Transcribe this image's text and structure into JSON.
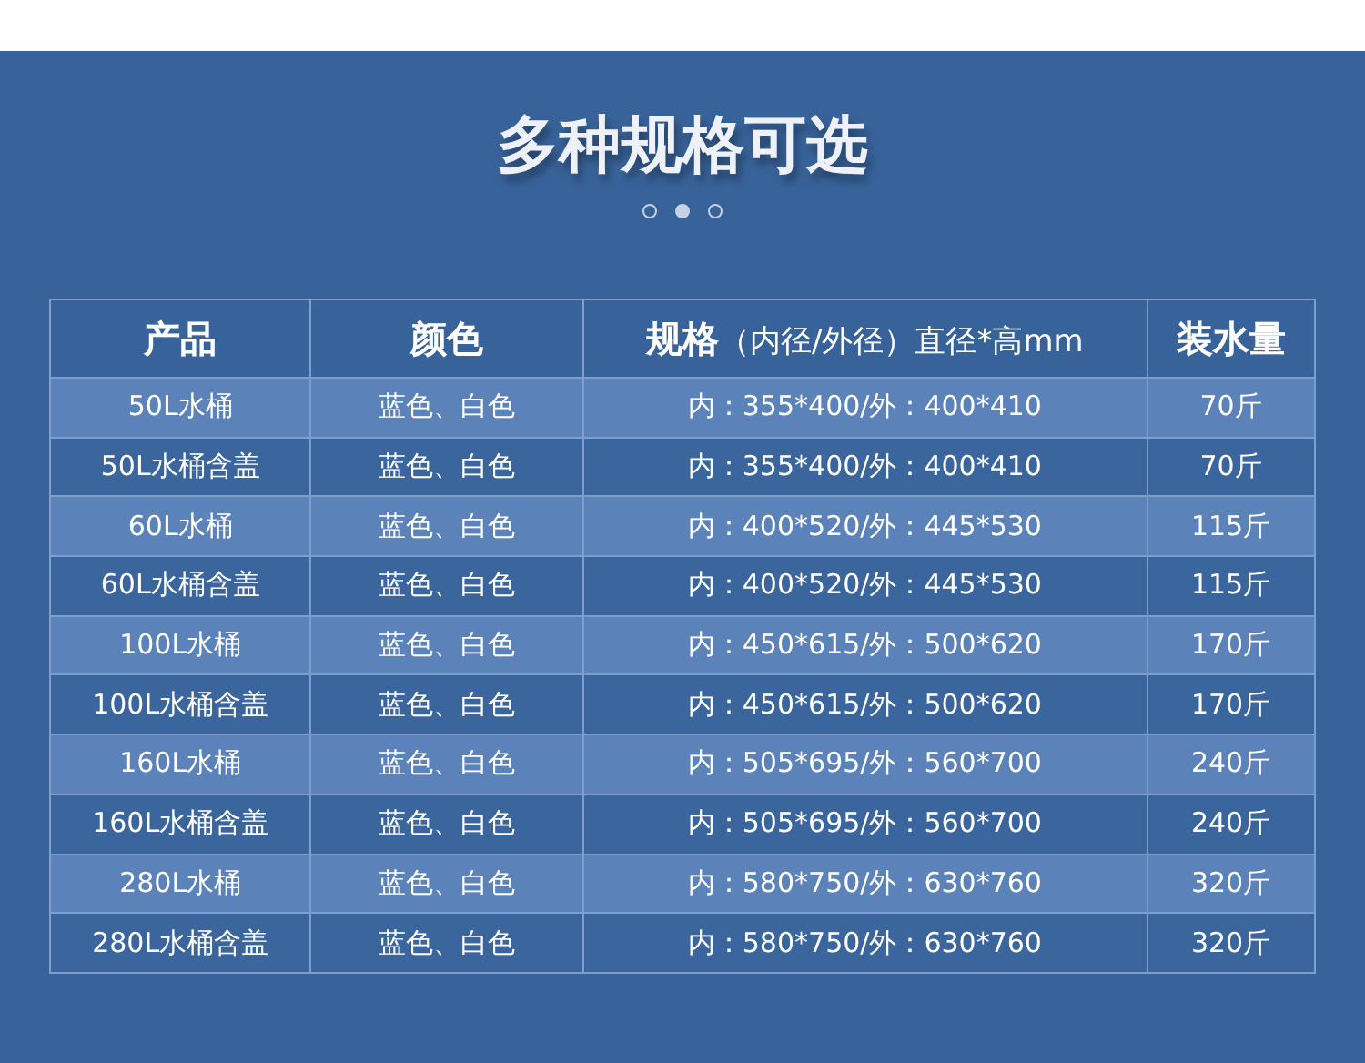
{
  "title": "多种规格可选",
  "pager": [
    {
      "selected": false
    },
    {
      "selected": true
    },
    {
      "selected": false
    }
  ],
  "table": {
    "columns": [
      "产品",
      "颜色",
      "**规格**（内径/外径）直径*高mm",
      "装水量"
    ],
    "rows": [
      [
        "50L水桶",
        "蓝色、白色",
        "内：355*400/外：400*410",
        "70斤"
      ],
      [
        "50L水桶含盖",
        "蓝色、白色",
        "内：355*400/外：400*410",
        "70斤"
      ],
      [
        "60L水桶",
        "蓝色、白色",
        "内：400*520/外：445*530",
        "115斤"
      ],
      [
        "60L水桶含盖",
        "蓝色、白色",
        "内：400*520/外：445*530",
        "115斤"
      ],
      [
        "100L水桶",
        "蓝色、白色",
        "内：450*615/外：500*620",
        "170斤"
      ],
      [
        "100L水桶含盖",
        "蓝色、白色",
        "内：450*615/外：500*620",
        "170斤"
      ],
      [
        "160L水桶",
        "蓝色、白色",
        "内：505*695/外：560*700",
        "240斤"
      ],
      [
        "160L水桶含盖",
        "蓝色、白色",
        "内：505*695/外：560*700",
        "240斤"
      ],
      [
        "280L水桶",
        "蓝色、白色",
        "内：580*750/外：630*760",
        "320斤"
      ],
      [
        "280L水桶含盖",
        "蓝色、白色",
        "内：580*750/外：630*760",
        "320斤"
      ]
    ]
  }
}
